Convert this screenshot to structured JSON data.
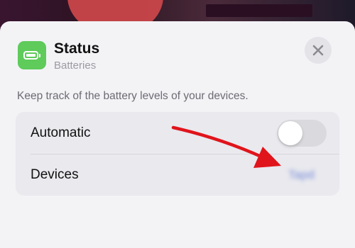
{
  "header": {
    "title": "Status",
    "subtitle": "Batteries",
    "app_icon": "battery-icon",
    "close_icon": "close-icon"
  },
  "description": "Keep track of the battery levels of your devices.",
  "settings": {
    "automatic": {
      "label": "Automatic",
      "toggle_on": false
    },
    "devices": {
      "label": "Devices",
      "value": "Tapd"
    }
  },
  "colors": {
    "app_icon_green": "#5ecb5b",
    "arrow_red": "#e0141b",
    "value_blue": "#7a8ed8"
  }
}
